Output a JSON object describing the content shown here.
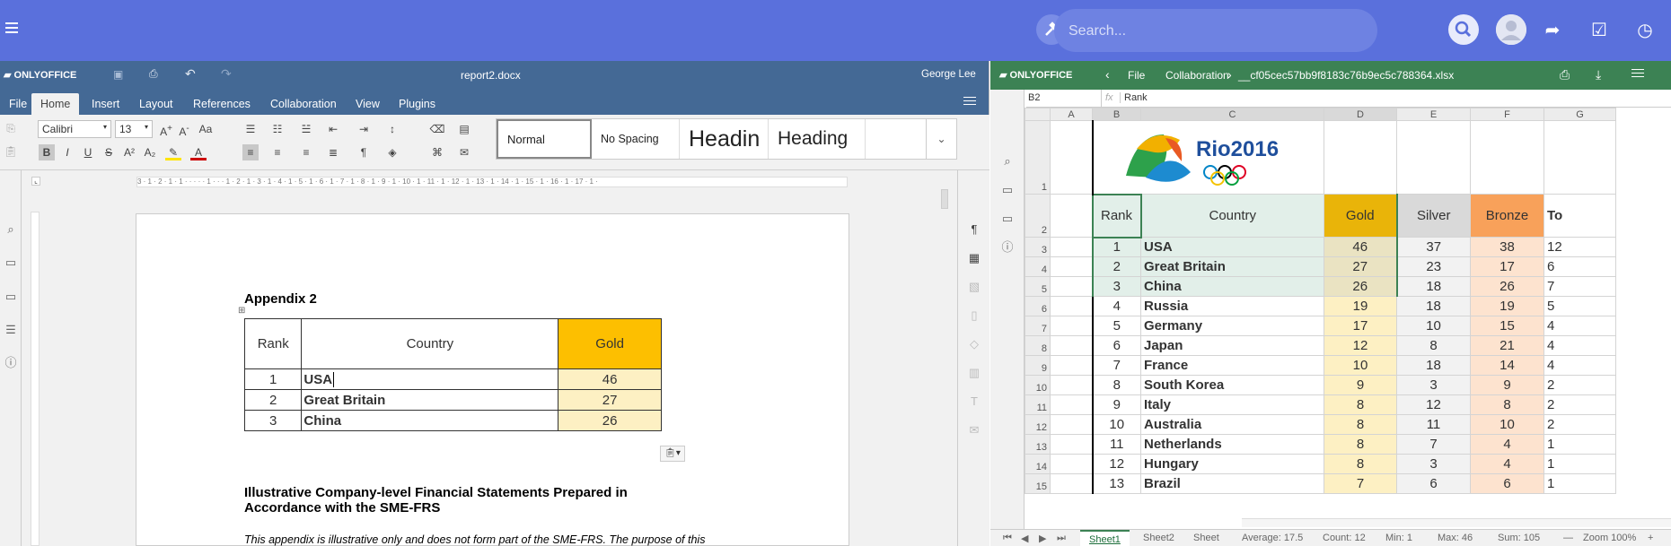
{
  "topbar": {
    "search_placeholder": "Search...",
    "colors": {
      "bar": "#5a70dc"
    }
  },
  "doc": {
    "brand": "ONLYOFFICE",
    "filename": "report2.docx",
    "user": "George Lee",
    "tabs": [
      "File",
      "Home",
      "Insert",
      "Layout",
      "References",
      "Collaboration",
      "View",
      "Plugins"
    ],
    "active_tab": "Home",
    "font_name": "Calibri",
    "font_size": "13",
    "styles": [
      "Normal",
      "No Spacing",
      "Headin",
      "Heading"
    ],
    "heading": "Appendix 2",
    "table": {
      "headers": [
        "Rank",
        "Country",
        "Gold"
      ],
      "rows": [
        [
          "1",
          "USA",
          "46"
        ],
        [
          "2",
          "Great Britain",
          "27"
        ],
        [
          "3",
          "China",
          "26"
        ]
      ]
    },
    "section_title": "Illustrative Company-level Financial Statements Prepared in Accordance with the SME-FRS",
    "body_text": "This appendix is illustrative only and does not form part of the SME-FRS. The purpose of this",
    "ruler_text": "3 · 1 · 2 · 1 · 1 · · · · · 1 · · · 1 · 2 · 1 · 3 · 1 · 4 · 1 · 5 · 1 · 6 · 1 · 7 · 1 · 8 · 1 · 9 · 1 · 10 · 1 · 11 · 1 · 12 · 1 · 13 · 1 · 14 · 1 · 15 · 1 · 16 · 1 · 17 · 1 ·"
  },
  "sheet": {
    "brand": "ONLYOFFICE",
    "menu": [
      "File",
      "Collaboration"
    ],
    "filename": "__cf05cec57bb9f8183c76b9ec5c788364.xlsx",
    "cell_ref": "B2",
    "fx": "fx",
    "formula": "Rank",
    "logo_text": "Rio2016",
    "columns": [
      "A",
      "B",
      "C",
      "D",
      "E",
      "F",
      "G"
    ],
    "header": [
      "Rank",
      "Country",
      "Gold",
      "Silver",
      "Bronze",
      "To"
    ],
    "rows": [
      [
        "1",
        "USA",
        "46",
        "37",
        "38",
        "12"
      ],
      [
        "2",
        "Great Britain",
        "27",
        "23",
        "17",
        "6"
      ],
      [
        "3",
        "China",
        "26",
        "18",
        "26",
        "7"
      ],
      [
        "4",
        "Russia",
        "19",
        "18",
        "19",
        "5"
      ],
      [
        "5",
        "Germany",
        "17",
        "10",
        "15",
        "4"
      ],
      [
        "6",
        "Japan",
        "12",
        "8",
        "21",
        "4"
      ],
      [
        "7",
        "France",
        "10",
        "18",
        "14",
        "4"
      ],
      [
        "8",
        "South Korea",
        "9",
        "3",
        "9",
        "2"
      ],
      [
        "9",
        "Italy",
        "8",
        "12",
        "8",
        "2"
      ],
      [
        "10",
        "Australia",
        "8",
        "11",
        "10",
        "2"
      ],
      [
        "11",
        "Netherlands",
        "8",
        "7",
        "4",
        "1"
      ],
      [
        "12",
        "Hungary",
        "8",
        "3",
        "4",
        "1"
      ],
      [
        "13",
        "Brazil",
        "7",
        "6",
        "6",
        "1"
      ]
    ],
    "row_numbers": [
      "1",
      "2",
      "3",
      "4",
      "5",
      "6",
      "7",
      "8",
      "9",
      "10",
      "11",
      "12",
      "13",
      "14",
      "15"
    ],
    "sheet_tabs": [
      "Sheet1",
      "Sheet2",
      "Sheet"
    ],
    "status": {
      "average": "Average: 17.5",
      "count": "Count: 12",
      "min": "Min: 1",
      "max": "Max: 46",
      "sum": "Sum: 105",
      "zoom": "Zoom 100%"
    },
    "colors": {
      "gold": "#e9b409",
      "silver": "#d9d9d9",
      "bronze": "#f8a15a",
      "header_bar": "#3c8254"
    }
  }
}
